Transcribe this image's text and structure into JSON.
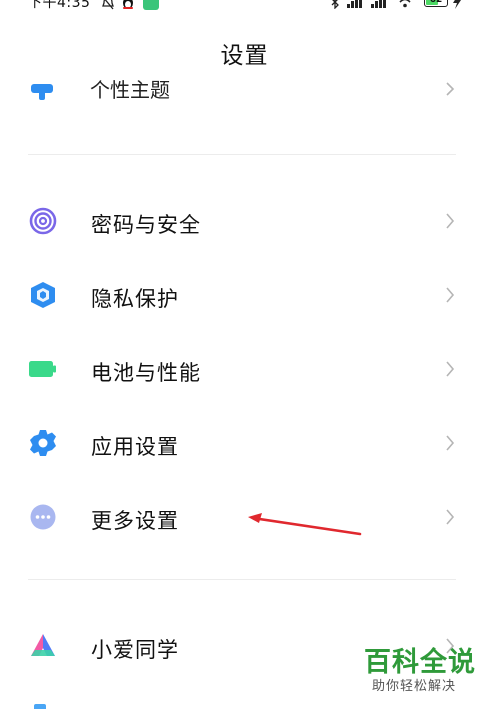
{
  "status_bar": {
    "time": "下午4:35",
    "icons": [
      "bell-off-icon",
      "penguin-icon",
      "app-notification-icon",
      "more-icon",
      "bluetooth-icon",
      "signal-icon",
      "signal-icon",
      "wifi-icon",
      "battery-icon",
      "charging-icon"
    ],
    "more": "···",
    "battery_level": "62",
    "battery_fraction": 0.62
  },
  "header": {
    "title": "设置"
  },
  "partial_item": {
    "label": "个性主题",
    "icon": "theme-icon"
  },
  "settings": [
    {
      "label": "密码与安全",
      "icon": "fingerprint-icon",
      "color": "#7a67e8"
    },
    {
      "label": "隐私保护",
      "icon": "privacy-shield-icon",
      "color": "#2e8df0"
    },
    {
      "label": "电池与性能",
      "icon": "battery-icon",
      "color": "#3ad98a"
    },
    {
      "label": "应用设置",
      "icon": "gear-icon",
      "color": "#2e8df0"
    },
    {
      "label": "更多设置",
      "icon": "more-dots-icon",
      "color": "#a9b7f0"
    }
  ],
  "settings2": [
    {
      "label": "小爱同学",
      "icon": "xiaoai-icon"
    }
  ],
  "annotation": {
    "arrow_color": "#e0282e"
  },
  "watermark": {
    "title": "百科全说",
    "subtitle": "助你轻松解决",
    "color": "#2f9a3a"
  }
}
